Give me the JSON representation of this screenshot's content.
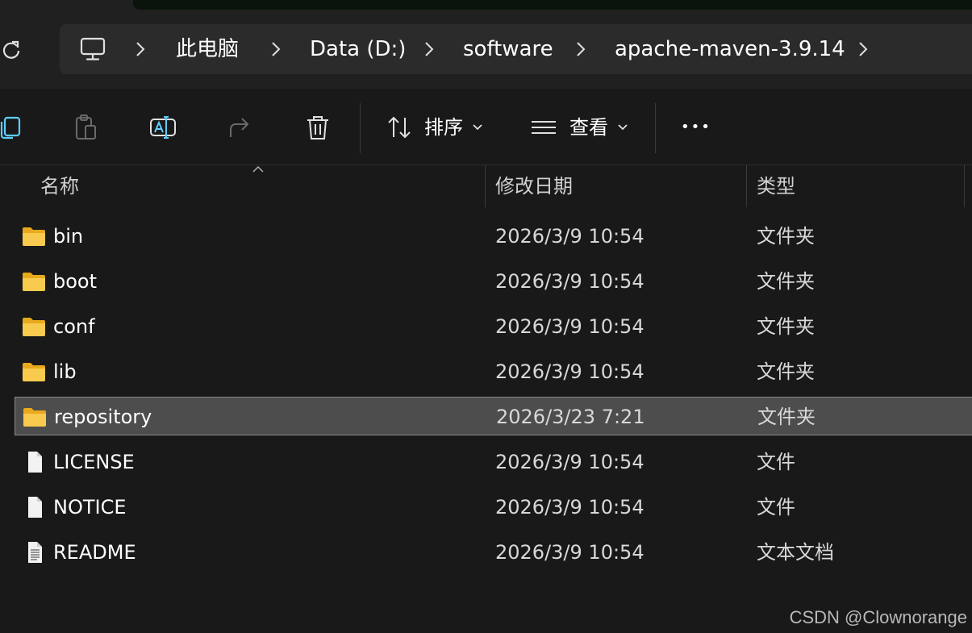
{
  "breadcrumb": {
    "items": [
      "此电脑",
      "Data (D:)",
      "software",
      "apache-maven-3.9.14"
    ]
  },
  "toolbar": {
    "sort_label": "排序",
    "view_label": "查看",
    "more_label": "•••"
  },
  "columns": {
    "name": "名称",
    "date": "修改日期",
    "type": "类型"
  },
  "files": [
    {
      "name": "bin",
      "date": "2026/3/9 10:54",
      "type": "文件夹",
      "icon": "folder-icon"
    },
    {
      "name": "boot",
      "date": "2026/3/9 10:54",
      "type": "文件夹",
      "icon": "folder-icon"
    },
    {
      "name": "conf",
      "date": "2026/3/9 10:54",
      "type": "文件夹",
      "icon": "folder-icon"
    },
    {
      "name": "lib",
      "date": "2026/3/9 10:54",
      "type": "文件夹",
      "icon": "folder-icon"
    },
    {
      "name": "repository",
      "date": "2026/3/23 7:21",
      "type": "文件夹",
      "icon": "folder-icon",
      "selected": true
    },
    {
      "name": "LICENSE",
      "date": "2026/3/9 10:54",
      "type": "文件",
      "icon": "file-icon"
    },
    {
      "name": "NOTICE",
      "date": "2026/3/9 10:54",
      "type": "文件",
      "icon": "file-icon"
    },
    {
      "name": "README",
      "date": "2026/3/9 10:54",
      "type": "文本文档",
      "icon": "text-document-icon"
    }
  ],
  "watermark": "CSDN @Clownorange",
  "colors": {
    "background": "#191919",
    "address_bar": "#2b2b2b",
    "selected_row": "#4d4d4d",
    "folder": "#f6c445",
    "accent": "#60cdff"
  }
}
